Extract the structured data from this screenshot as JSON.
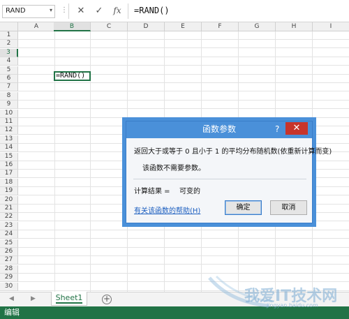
{
  "formula_bar": {
    "name_box": "RAND",
    "name_box_caret": "▾",
    "separator": "⋮",
    "cancel_glyph": "✕",
    "enter_glyph": "✓",
    "fx_label": "fx",
    "formula": "=RAND()"
  },
  "columns": [
    "A",
    "B",
    "C",
    "D",
    "E",
    "F",
    "G",
    "H",
    "I"
  ],
  "active_column": "B",
  "rows": [
    "1",
    "2",
    "3",
    "4",
    "5",
    "6",
    "7",
    "8",
    "9",
    "10",
    "11",
    "12",
    "13",
    "14",
    "15",
    "16",
    "17",
    "18",
    "19",
    "20",
    "21",
    "22",
    "23",
    "24",
    "25",
    "26",
    "27",
    "28",
    "29",
    "30"
  ],
  "active_row": "3",
  "active_cell": {
    "ref": "B3",
    "value": "=RAND()"
  },
  "sheet_tabs": {
    "nav_left": "◀",
    "nav_right": "▶",
    "tabs": [
      {
        "label": "Sheet1",
        "active": true
      }
    ],
    "add_label": "+"
  },
  "status_bar": {
    "mode": "编辑"
  },
  "dialog": {
    "title": "函数参数",
    "help_glyph": "?",
    "close_glyph": "✕",
    "description": "返回大于或等于 0 且小于 1 的平均分布随机数(依重新计算而变)",
    "no_params": "该函数不需要参数。",
    "result_label": "计算结果 =",
    "result_value": "可变的",
    "help_link": "有关该函数的帮助(H)",
    "ok_label": "确定",
    "cancel_label": "取消"
  },
  "watermark": {
    "text": "我爱IT技术网",
    "sub": "jingyan.baidu.com"
  },
  "colors": {
    "excel_green": "#217346",
    "dialog_blue": "#4a90d9",
    "close_red": "#c7342b",
    "link_blue": "#1a5dbf"
  }
}
